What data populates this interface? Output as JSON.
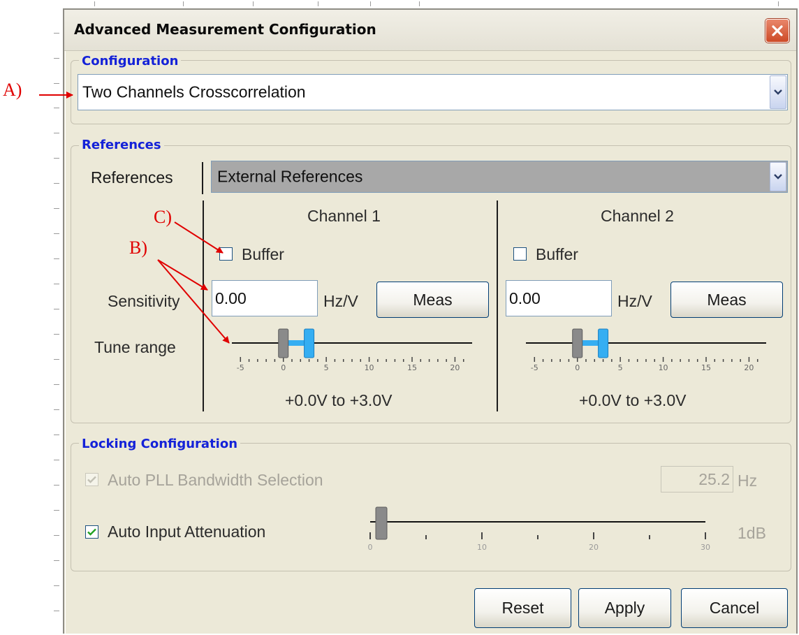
{
  "window": {
    "title": "Advanced Measurement Configuration",
    "close_icon": "close-icon"
  },
  "configuration": {
    "legend": "Configuration",
    "selected": "Two Channels Crosscorrelation"
  },
  "references": {
    "legend": "References",
    "label": "References",
    "selected": "External References",
    "row_labels": {
      "sensitivity": "Sensitivity",
      "tune_range": "Tune range"
    },
    "channels": [
      {
        "title": "Channel 1",
        "buffer_label": "Buffer",
        "buffer_checked": false,
        "sensitivity_value": "0.00",
        "unit": "Hz/V",
        "meas_label": "Meas",
        "tune_range_low_v": 0.0,
        "tune_range_high_v": 3.0,
        "tune_range_text": "+0.0V to +3.0V",
        "scale_labels": [
          "-5",
          "0",
          "5",
          "10",
          "15",
          "20"
        ]
      },
      {
        "title": "Channel 2",
        "buffer_label": "Buffer",
        "buffer_checked": false,
        "sensitivity_value": "0.00",
        "unit": "Hz/V",
        "meas_label": "Meas",
        "tune_range_low_v": 0.0,
        "tune_range_high_v": 3.0,
        "tune_range_text": "+0.0V to +3.0V",
        "scale_labels": [
          "-5",
          "0",
          "5",
          "10",
          "15",
          "20"
        ]
      }
    ]
  },
  "locking": {
    "legend": "Locking Configuration",
    "auto_pll_label": "Auto PLL Bandwidth Selection",
    "auto_pll_checked": true,
    "auto_pll_enabled": false,
    "bandwidth_value": "25.2",
    "bandwidth_unit": "Hz",
    "auto_atten_label": "Auto Input Attenuation",
    "auto_atten_checked": true,
    "attenuation_value_db": 1,
    "attenuation_text": "1dB",
    "atten_scale_labels": [
      "0",
      "10",
      "20",
      "30"
    ]
  },
  "buttons": {
    "reset": "Reset",
    "apply": "Apply",
    "cancel": "Cancel"
  },
  "annotations": {
    "a": "A)",
    "b": "B)",
    "c": "C)"
  },
  "colors": {
    "accent_blue": "#1422d8",
    "slider_blue": "#35aef2",
    "annotation_red": "#e00000"
  }
}
